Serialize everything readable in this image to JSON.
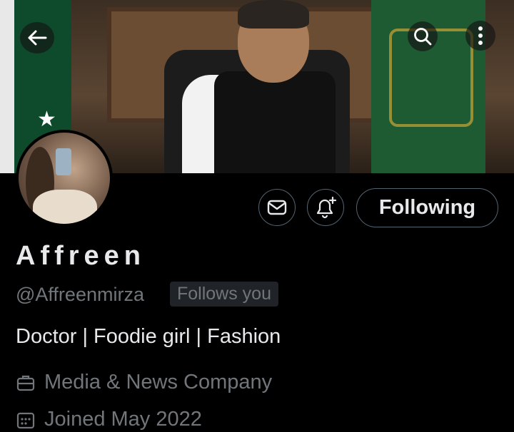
{
  "profile": {
    "display_name": "Affreen",
    "handle": "@Affreenmirza",
    "follows_badge": "Follows you",
    "bio": "Doctor | Foodie girl | Fashion",
    "category": "Media & News Company",
    "joined": "Joined May 2022"
  },
  "actions": {
    "follow_label": "Following"
  },
  "icons": {
    "back": "back-arrow-icon",
    "search": "search-icon",
    "more": "more-vertical-icon",
    "message": "envelope-icon",
    "notify": "bell-plus-icon",
    "category": "briefcase-icon",
    "joined": "calendar-icon"
  },
  "colors": {
    "background": "#000000",
    "text_primary": "#e7e9ea",
    "text_secondary": "#71767b",
    "border": "#536471"
  }
}
